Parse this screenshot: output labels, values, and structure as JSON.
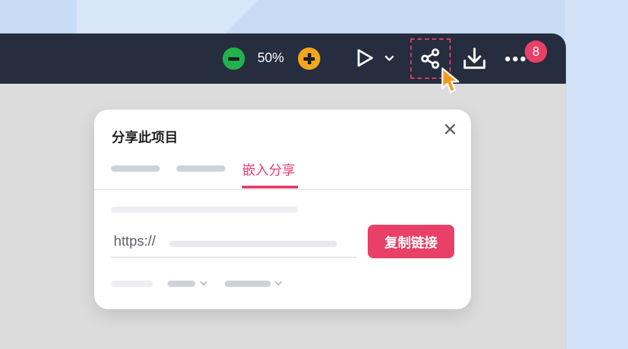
{
  "toolbar": {
    "zoom_out_icon": "minus-circle-icon",
    "zoom_level": "50%",
    "zoom_in_icon": "plus-circle-icon",
    "play_icon": "play-icon",
    "share_icon": "share-icon",
    "download_icon": "download-icon",
    "more_icon": "more-dots-icon",
    "notification_count": "8",
    "colors": {
      "background": "#252d3f",
      "zoom_out": "#22b14c",
      "zoom_in": "#f3a51e",
      "accent": "#e84067"
    }
  },
  "dialog": {
    "title": "分享此项目",
    "active_tab": "嵌入分享",
    "url_prefix": "https://",
    "copy_button": "复制链接",
    "close_icon": "close-icon"
  }
}
